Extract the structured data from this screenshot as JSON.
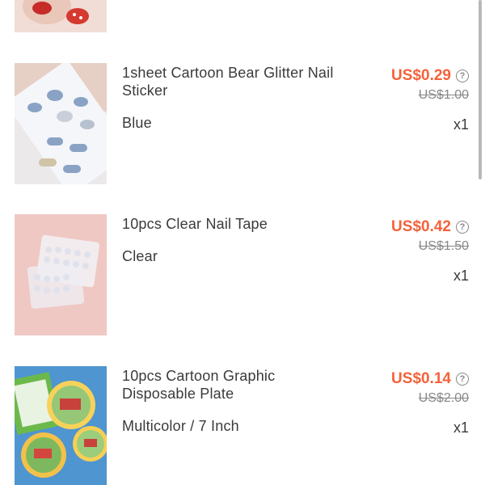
{
  "items": [
    {
      "title": "1sheet Cartoon Bear Glitter Nail Sticker",
      "variant": "Blue",
      "price": "US$0.29",
      "original_price": "US$1.00",
      "quantity": "x1"
    },
    {
      "title": "10pcs Clear Nail Tape",
      "variant": "Clear",
      "price": "US$0.42",
      "original_price": "US$1.50",
      "quantity": "x1"
    },
    {
      "title": "10pcs Cartoon Graphic Disposable Plate",
      "variant": "Multicolor / 7 Inch",
      "price": "US$0.14",
      "original_price": "US$2.00",
      "quantity": "x1"
    }
  ],
  "help_glyph": "?",
  "accent_color": "#f4623a"
}
